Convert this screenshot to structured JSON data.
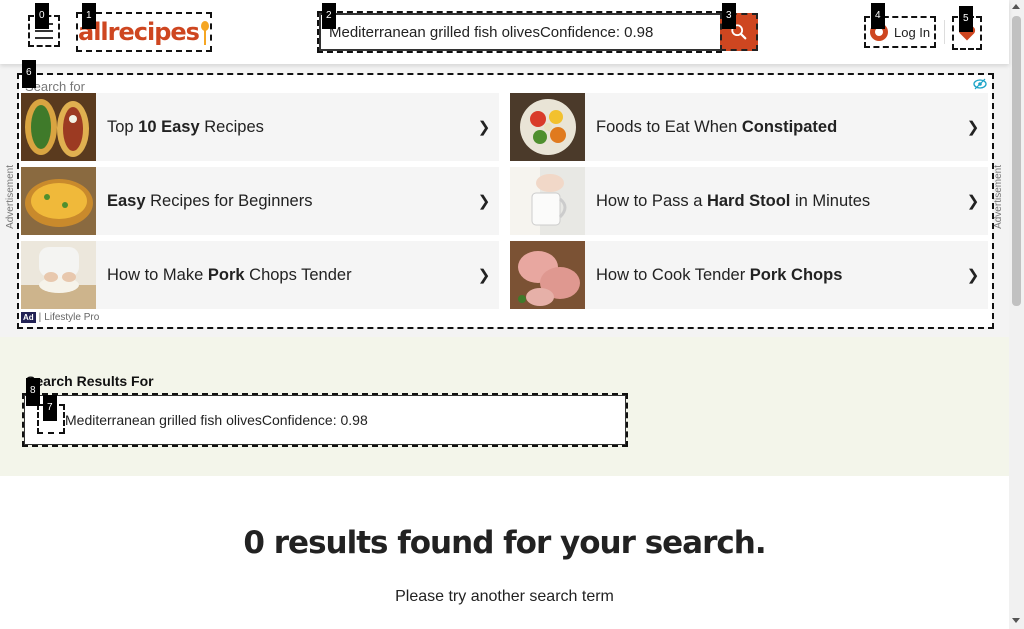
{
  "header": {
    "menu_icon": "hamburger-menu-icon",
    "logo_text": "allrecipes",
    "search_value": "Mediterranean grilled fish olivesConfidence: 0.98",
    "search_icon": "magnifier-icon",
    "login_label": "Log In",
    "saved_icon": "heart-icon"
  },
  "ad": {
    "search_for_label": "Search for",
    "side_label": "Advertisement",
    "sponsor": "Lifestyle Pro",
    "ad_tag": "Ad",
    "chevron": "❯",
    "items": [
      {
        "pre": "Top ",
        "bold": "10 Easy",
        "post": " Recipes"
      },
      {
        "pre": "Foods to Eat When ",
        "bold": "Constipated",
        "post": ""
      },
      {
        "pre": "",
        "bold": "Easy",
        "post": " Recipes for Beginners"
      },
      {
        "pre": "How to Pass a ",
        "bold": "Hard Stool",
        "post": " in Minutes"
      },
      {
        "pre": "How to Make ",
        "bold": "Pork",
        "post": " Chops Tender"
      },
      {
        "pre": "How to Cook Tender ",
        "bold": "Pork Chops",
        "post": ""
      }
    ]
  },
  "results": {
    "heading": "Search Results For",
    "query": "Mediterranean grilled fish olivesConfidence: 0.98"
  },
  "empty_state": {
    "title": "0 results found for your search.",
    "subtitle": "Please try another search term"
  },
  "badges": [
    "0",
    "1",
    "2",
    "3",
    "4",
    "5",
    "6",
    "7",
    "8"
  ],
  "colors": {
    "brand": "#ce4620",
    "accent_spoon": "#f5a623",
    "results_band": "#f3f5ea"
  }
}
